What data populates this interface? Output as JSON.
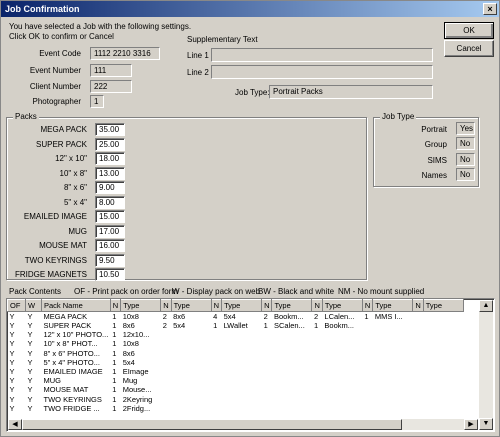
{
  "window": {
    "title": "Job Confirmation"
  },
  "intro": {
    "line1": "You have selected a Job with the following settings.",
    "line2": "Click OK to confirm or Cancel"
  },
  "buttons": {
    "ok": "OK",
    "cancel": "Cancel"
  },
  "job": {
    "event_code_label": "Event Code",
    "event_code": "1112 2210 3316",
    "event_number_label": "Event Number",
    "event_number": "111",
    "client_number_label": "Client Number",
    "client_number": "222",
    "photographer_label": "Photographer",
    "photographer": "1"
  },
  "supplementary": {
    "title": "Supplementary Text",
    "line1_label": "Line 1",
    "line1": "",
    "line2_label": "Line 2",
    "line2": "",
    "job_type_label": "Job Type:",
    "job_type": "Portrait Packs"
  },
  "packs": {
    "title": "Packs",
    "items": [
      {
        "label": "MEGA PACK",
        "value": "35.00"
      },
      {
        "label": "SUPER PACK",
        "value": "25.00"
      },
      {
        "label": "12\" x 10\"",
        "value": "18.00"
      },
      {
        "label": "10\" x 8\"",
        "value": "13.00"
      },
      {
        "label": "8\" x 6\"",
        "value": "9.00"
      },
      {
        "label": "5\" x 4\"",
        "value": "8.00"
      },
      {
        "label": "EMAILED IMAGE",
        "value": "15.00"
      },
      {
        "label": "MUG",
        "value": "17.00"
      },
      {
        "label": "MOUSE MAT",
        "value": "16.00"
      },
      {
        "label": "TWO KEYRINGS",
        "value": "9.50"
      },
      {
        "label": "FRIDGE MAGNETS",
        "value": "10.50"
      }
    ]
  },
  "job_type_box": {
    "title": "Job Type",
    "items": [
      {
        "label": "Portrait",
        "value": "Yes"
      },
      {
        "label": "Group",
        "value": "No"
      },
      {
        "label": "SIMS",
        "value": "No"
      },
      {
        "label": "Names",
        "value": "No"
      }
    ]
  },
  "legend": {
    "title": "Pack Contents",
    "of": "OF - Print pack on order form",
    "w": "W - Display pack on web",
    "bw": "BW - Black and white",
    "nm": "NM - No mount supplied"
  },
  "table": {
    "columns": [
      "OF",
      "W",
      "Pack Name",
      "N",
      "Type",
      "N",
      "Type",
      "N",
      "Type",
      "N",
      "Type",
      "N",
      "Type",
      "N",
      "Type",
      "N",
      "Type"
    ],
    "rows": [
      [
        "Y",
        "Y",
        "MEGA PACK",
        "1",
        "10x8",
        "2",
        "8x6",
        "4",
        "5x4",
        "2",
        "Bookm...",
        "2",
        "LCalen...",
        "1",
        "MMS I...",
        "",
        ""
      ],
      [
        "Y",
        "Y",
        "SUPER PACK",
        "1",
        "8x6",
        "2",
        "5x4",
        "1",
        "LWallet",
        "1",
        "SCalen...",
        "1",
        "Bookm...",
        "",
        "",
        "",
        ""
      ],
      [
        "Y",
        "Y",
        "12\" x 10\" PHOTO...",
        "1",
        "12x10...",
        "",
        "",
        "",
        "",
        "",
        "",
        "",
        "",
        "",
        "",
        "",
        ""
      ],
      [
        "Y",
        "Y",
        "10\" x 8\" PHOT...",
        "1",
        "10x8",
        "",
        "",
        "",
        "",
        "",
        "",
        "",
        "",
        "",
        "",
        "",
        ""
      ],
      [
        "Y",
        "Y",
        "8\" x 6\" PHOTO...",
        "1",
        "8x6",
        "",
        "",
        "",
        "",
        "",
        "",
        "",
        "",
        "",
        "",
        "",
        ""
      ],
      [
        "Y",
        "Y",
        "5\" x 4\" PHOTO...",
        "1",
        "5x4",
        "",
        "",
        "",
        "",
        "",
        "",
        "",
        "",
        "",
        "",
        "",
        ""
      ],
      [
        "Y",
        "Y",
        "EMAILED IMAGE",
        "1",
        "EImage",
        "",
        "",
        "",
        "",
        "",
        "",
        "",
        "",
        "",
        "",
        "",
        ""
      ],
      [
        "Y",
        "Y",
        "MUG",
        "1",
        "Mug",
        "",
        "",
        "",
        "",
        "",
        "",
        "",
        "",
        "",
        "",
        "",
        ""
      ],
      [
        "Y",
        "Y",
        "MOUSE MAT",
        "1",
        "Mouse...",
        "",
        "",
        "",
        "",
        "",
        "",
        "",
        "",
        "",
        "",
        "",
        ""
      ],
      [
        "Y",
        "Y",
        "TWO KEYRINGS",
        "1",
        "2Keyring",
        "",
        "",
        "",
        "",
        "",
        "",
        "",
        "",
        "",
        "",
        "",
        ""
      ],
      [
        "Y",
        "Y",
        "TWO FRIDGE ...",
        "1",
        "2Fridg...",
        "",
        "",
        "",
        "",
        "",
        "",
        "",
        "",
        "",
        "",
        "",
        ""
      ]
    ]
  }
}
